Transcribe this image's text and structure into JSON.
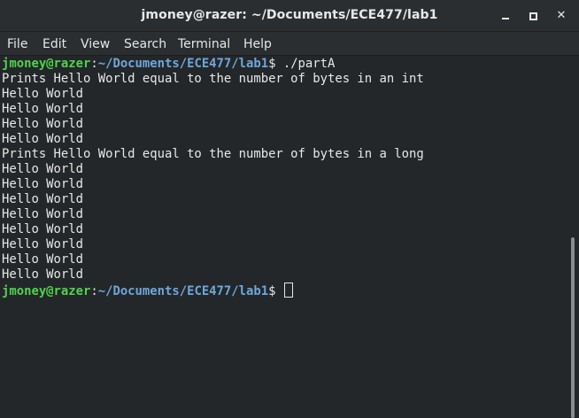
{
  "window": {
    "title": "jmoney@razer: ~/Documents/ECE477/lab1",
    "close_glyph": "✕"
  },
  "menu": [
    "File",
    "Edit",
    "View",
    "Search",
    "Terminal",
    "Help"
  ],
  "prompt": {
    "user_host": "jmoney@razer",
    "separator": ":",
    "path": "~/Documents/ECE477/lab1",
    "dollar": "$"
  },
  "terminal": {
    "command": " ./partA",
    "output": [
      "Prints Hello World equal to the number of bytes in an int",
      "Hello World",
      "Hello World",
      "Hello World",
      "Hello World",
      "Prints Hello World equal to the number of bytes in a long",
      "Hello World",
      "Hello World",
      "Hello World",
      "Hello World",
      "Hello World",
      "Hello World",
      "Hello World",
      "Hello World"
    ]
  },
  "colors": {
    "background": "#232729",
    "prompt_user": "#4fd34c",
    "prompt_path": "#6fa6db",
    "text": "#e7e7e7"
  },
  "icons": {
    "minimize": "minimize-icon",
    "maximize": "maximize-icon",
    "close": "close-icon"
  }
}
